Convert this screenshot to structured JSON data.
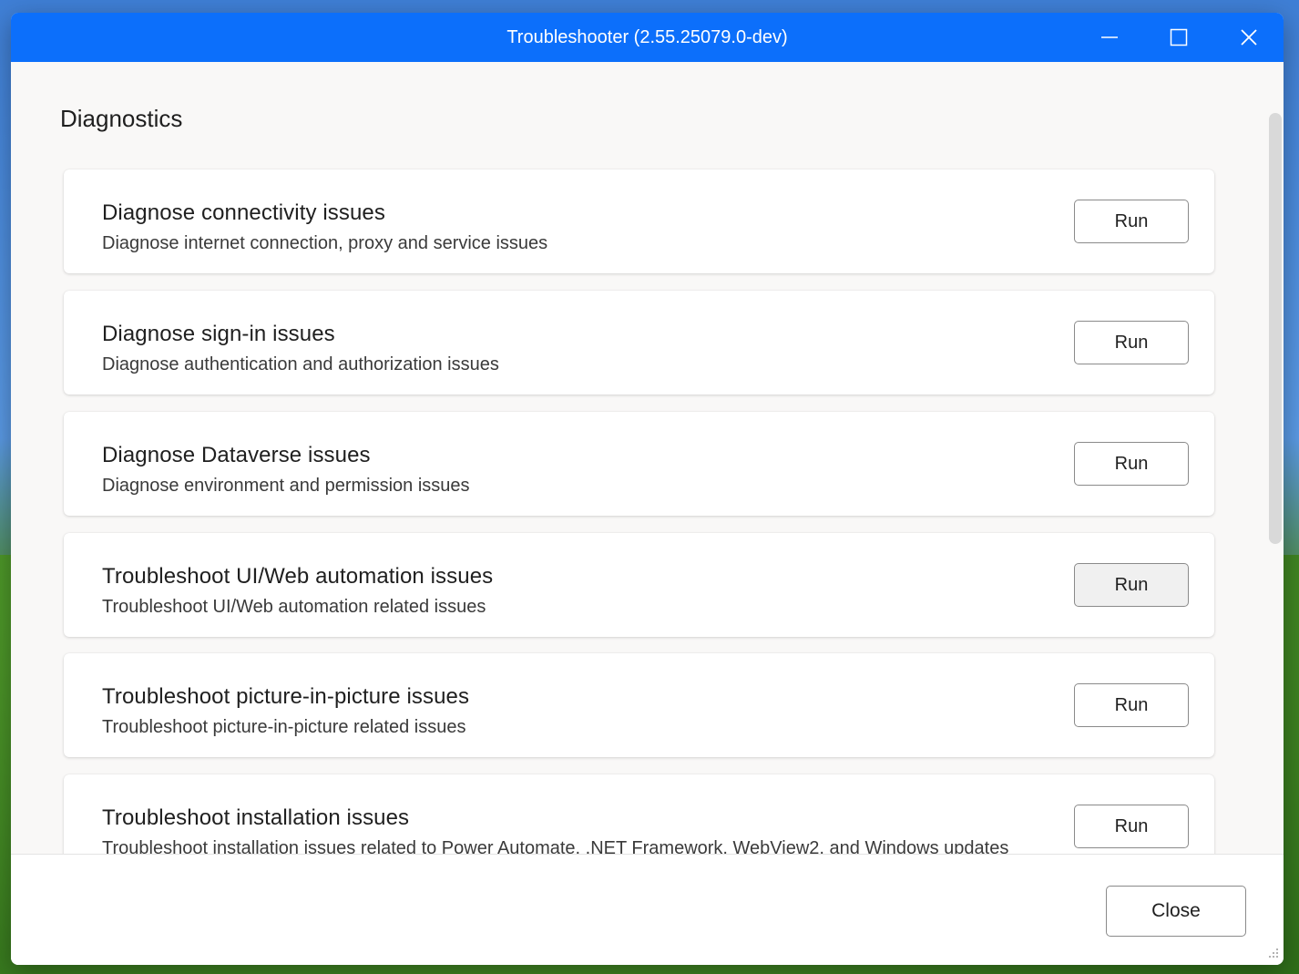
{
  "window": {
    "title": "Troubleshooter (2.55.25079.0-dev)"
  },
  "main": {
    "section_title": "Diagnostics",
    "items": [
      {
        "title": "Diagnose connectivity issues",
        "description": "Diagnose internet connection, proxy and service issues",
        "button": "Run"
      },
      {
        "title": "Diagnose sign-in issues",
        "description": "Diagnose authentication and authorization issues",
        "button": "Run"
      },
      {
        "title": "Diagnose Dataverse issues",
        "description": "Diagnose environment and permission issues",
        "button": "Run"
      },
      {
        "title": "Troubleshoot UI/Web automation issues",
        "description": "Troubleshoot UI/Web automation related issues",
        "button": "Run"
      },
      {
        "title": "Troubleshoot picture-in-picture issues",
        "description": "Troubleshoot picture-in-picture related issues",
        "button": "Run"
      },
      {
        "title": "Troubleshoot installation issues",
        "description": "Troubleshoot installation issues related to Power Automate, .NET Framework, WebView2, and Windows updates",
        "button": "Run"
      }
    ]
  },
  "footer": {
    "close_label": "Close"
  },
  "colors": {
    "titlebar": "#0c6ffb",
    "background": "#f9f8f7"
  }
}
